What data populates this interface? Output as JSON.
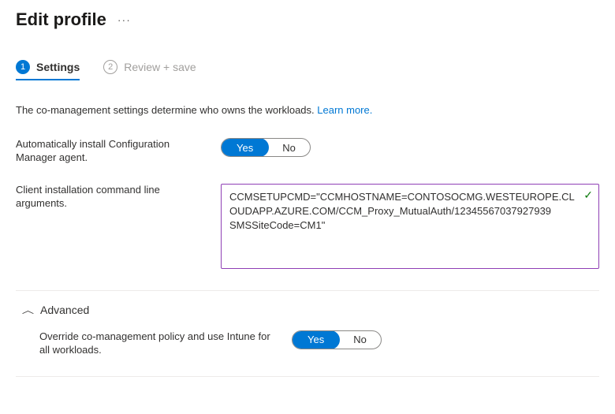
{
  "header": {
    "title": "Edit profile"
  },
  "tabs": [
    {
      "num": "1",
      "label": "Settings"
    },
    {
      "num": "2",
      "label": "Review + save"
    }
  ],
  "description": "The co-management settings determine who owns the workloads.",
  "learn_more": "Learn more.",
  "settings": {
    "auto_install": {
      "label": "Automatically install Configuration Manager agent.",
      "yes": "Yes",
      "no": "No"
    },
    "cmdline": {
      "label": "Client installation command line arguments.",
      "value": "CCMSETUPCMD=\"CCMHOSTNAME=CONTOSOCMG.WESTEUROPE.CLOUDAPP.AZURE.COM/CCM_Proxy_MutualAuth/12345567037927939 SMSSiteCode=CM1\""
    }
  },
  "advanced": {
    "title": "Advanced",
    "override": {
      "label": "Override co-management policy and use Intune for all workloads.",
      "yes": "Yes",
      "no": "No"
    }
  }
}
